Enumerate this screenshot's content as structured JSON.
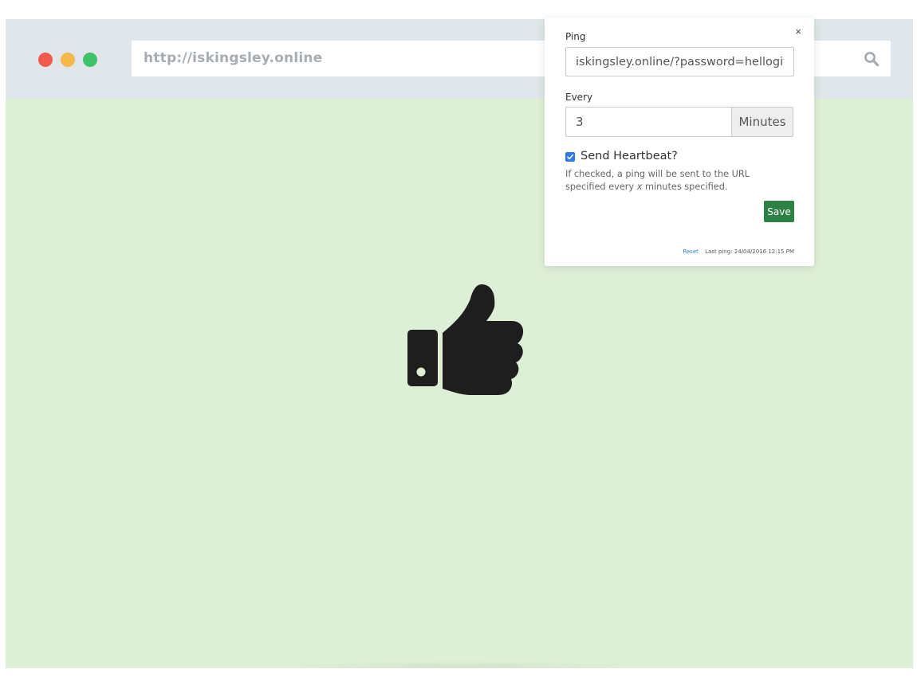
{
  "browser": {
    "url": "http://iskingsley.online"
  },
  "icons": {
    "main": "thumbs-up-icon",
    "search": "search-icon",
    "close": "close-icon"
  },
  "colors": {
    "page_background": "#deefd7",
    "save_button": "#2e8046",
    "link": "#2f80d6",
    "checkbox": "#2f7be6"
  },
  "popup": {
    "close_label": "×",
    "ping_label": "Ping",
    "ping_value": "iskingsley.online/?password=hellogithub",
    "every_label": "Every",
    "every_value": "3",
    "every_unit": "Minutes",
    "heartbeat_label": "Send Heartbeat?",
    "heartbeat_checked": true,
    "help_before": "If checked, a ping will be sent to the URL specified every ",
    "help_var": "x",
    "help_after": " minutes specified.",
    "save_label": "Save",
    "reset_label": "Reset",
    "last_ping": "Last ping: 24/04/2016 12:15 PM"
  }
}
